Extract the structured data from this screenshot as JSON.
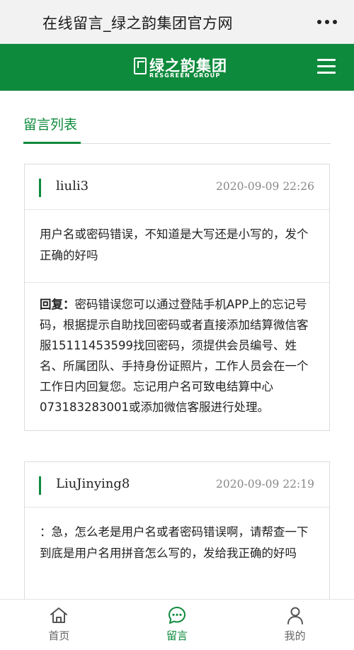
{
  "topbar": {
    "title": "在线留言_绿之韵集团官方网"
  },
  "header": {
    "logo_cn": "绿之韵集团",
    "logo_en": "RESGREEN GROUP"
  },
  "section": {
    "title": "留言列表"
  },
  "messages": [
    {
      "user": "liuli3",
      "time": "2020-09-09 22:26",
      "content": "用户名或密码错误，不知道是大写还是小写的，发个正确的好吗",
      "reply_label": "回复：",
      "reply": "密码错误您可以通过登陆手机APP上的忘记号码，根据提示自助找回密码或者直接添加结算微信客服15111453599找回密码，须提供会员编号、姓名、所属团队、手持身份证照片，工作人员会在一个工作日内回复您。忘记用户名可致电结算中心073183283001或添加微信客服进行处理。"
    },
    {
      "user": "LiuJinying8",
      "time": "2020-09-09 22:19",
      "content": "：急，怎么老是用户名或者密码错误啊，请帮查一下到底是用户名用拼音怎么写的，发给我正确的好吗"
    }
  ],
  "nav": {
    "items": [
      {
        "label": "首页",
        "icon": "home-icon"
      },
      {
        "label": "留言",
        "icon": "message-icon",
        "active": true
      },
      {
        "label": "我的",
        "icon": "user-icon"
      }
    ]
  },
  "colors": {
    "brand": "#0d8a3c",
    "topbar_bg": "#f2f2f2",
    "text": "#222222",
    "muted": "#888888"
  }
}
